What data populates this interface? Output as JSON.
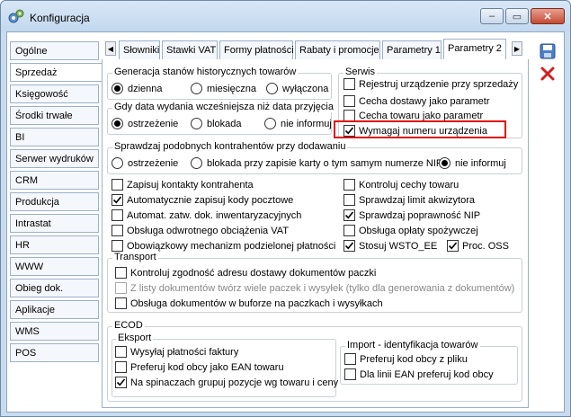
{
  "window": {
    "title": "Konfiguracja",
    "min": "–",
    "max": "▭",
    "close": "✕"
  },
  "sidebar": [
    "Ogólne",
    "Sprzedaż",
    "Księgowość",
    "Środki trwałe",
    "BI",
    "Serwer wydruków",
    "CRM",
    "Produkcja",
    "Intrastat",
    "HR",
    "WWW",
    "Obieg dok.",
    "Aplikacje",
    "WMS",
    "POS"
  ],
  "sidebar_active": 1,
  "tabs": [
    "Słowniki",
    "Stawki VAT",
    "Formy płatności",
    "Rabaty i promocje",
    "Parametry 1",
    "Parametry 2"
  ],
  "tab_active": 5,
  "tab_scroll": {
    "left": "◀",
    "right": "▶"
  },
  "gen_hist": {
    "title": "Generacja stanów historycznych towarów",
    "opts": [
      "dzienna",
      "miesięczna",
      "wyłączona"
    ],
    "selected": 0
  },
  "date_warn": {
    "title": "Gdy data wydania wcześniejsza niż data przyjęcia",
    "opts": [
      "ostrzeżenie",
      "blokada",
      "nie informuj"
    ],
    "selected": 0
  },
  "serwis": {
    "title": "Serwis",
    "items": [
      {
        "label": "Rejestruj urządzenie przy sprzedaży",
        "checked": false
      },
      {
        "label": "Cecha dostawy jako parametr",
        "checked": false
      },
      {
        "label": "Cecha towaru jako parametr",
        "checked": false
      },
      {
        "label": "Wymagaj numeru urządzenia",
        "checked": true
      }
    ]
  },
  "similar": {
    "title": "Sprawdzaj podobnych kontrahentów przy dodawaniu",
    "opts": [
      "ostrzeżenie",
      "blokada przy zapisie karty o tym samym numerze NIP",
      "nie informuj"
    ],
    "selected": 2
  },
  "left_checks": [
    {
      "label": "Zapisuj kontakty kontrahenta",
      "checked": false
    },
    {
      "label": "Automatycznie zapisuj kody pocztowe",
      "checked": true
    },
    {
      "label": "Automat. zatw. dok. inwentaryzacyjnych",
      "checked": false
    },
    {
      "label": "Obsługa odwrotnego obciążenia VAT",
      "checked": false
    },
    {
      "label": "Obowiązkowy mechanizm podzielonej płatności",
      "checked": false
    }
  ],
  "right_checks": [
    {
      "label": "Kontroluj cechy towaru",
      "checked": false
    },
    {
      "label": "Sprawdzaj limit akwizytora",
      "checked": false
    },
    {
      "label": "Sprawdzaj poprawność NIP",
      "checked": true
    },
    {
      "label": "Obsługa opłaty spożywczej",
      "checked": false
    },
    {
      "label": "Stosuj WSTO_EE",
      "checked": true
    },
    {
      "label": "Proc. OSS",
      "checked": true
    }
  ],
  "transport": {
    "title": "Transport",
    "items": [
      {
        "label": "Kontroluj zgodność adresu dostawy dokumentów paczki",
        "checked": false,
        "disabled": false
      },
      {
        "label": "Z listy dokumentów twórz wiele paczek i wysyłek (tylko dla generowania z dokumentów)",
        "checked": false,
        "disabled": true
      },
      {
        "label": "Obsługa dokumentów w buforze na paczkach i wysyłkach",
        "checked": false,
        "disabled": false
      }
    ]
  },
  "ecod": {
    "title": "ECOD",
    "export_title": "Eksport",
    "export": [
      {
        "label": "Wysyłaj płatności faktury",
        "checked": false
      },
      {
        "label": "Preferuj kod obcy jako EAN towaru",
        "checked": false
      },
      {
        "label": "Na spinaczach grupuj pozycje wg towaru i ceny",
        "checked": true
      }
    ],
    "import_title": "Import - identyfikacja towarów",
    "import": [
      {
        "label": "Preferuj kod obcy z pliku",
        "checked": false
      },
      {
        "label": "Dla linii EAN preferuj kod obcy",
        "checked": false
      }
    ]
  },
  "colors": {
    "accent": "#2a62b8",
    "highlight": "#e01010"
  }
}
